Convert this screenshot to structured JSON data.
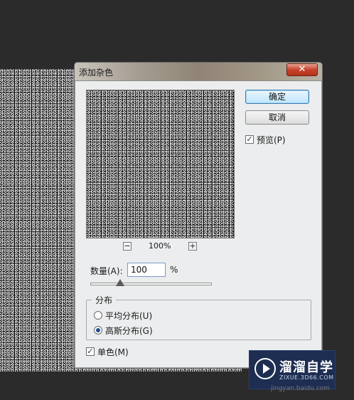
{
  "dialog": {
    "title": "添加杂色",
    "close_label": "✕",
    "buttons": {
      "ok_label": "确定",
      "cancel_label": "取消"
    },
    "preview": {
      "label": "预览(P)",
      "checked": true,
      "zoom_value": "100%",
      "zoom_minus": "−",
      "zoom_plus": "+"
    },
    "amount": {
      "label": "数量(A):",
      "value": "100",
      "unit": "%",
      "slider_level_percent": 25
    },
    "distribution": {
      "title": "分布",
      "options": [
        {
          "label": "平均分布(U)",
          "selected": false
        },
        {
          "label": "高斯分布(G)",
          "selected": true
        }
      ]
    },
    "monochromatic": {
      "label": "单色(M)",
      "checked": true
    },
    "check_glyph": "✓"
  },
  "watermark": {
    "name": "溜溜自学",
    "url": "ZIXUE.3D66.COM"
  },
  "footer": {
    "text": "jingyan.baidu.com"
  },
  "colors": {
    "dialog_bg": "#ecedee",
    "workspace_bg": "#2b2b2b",
    "close_button": "#c8432b",
    "watermark_bg": "#1d2e52"
  }
}
